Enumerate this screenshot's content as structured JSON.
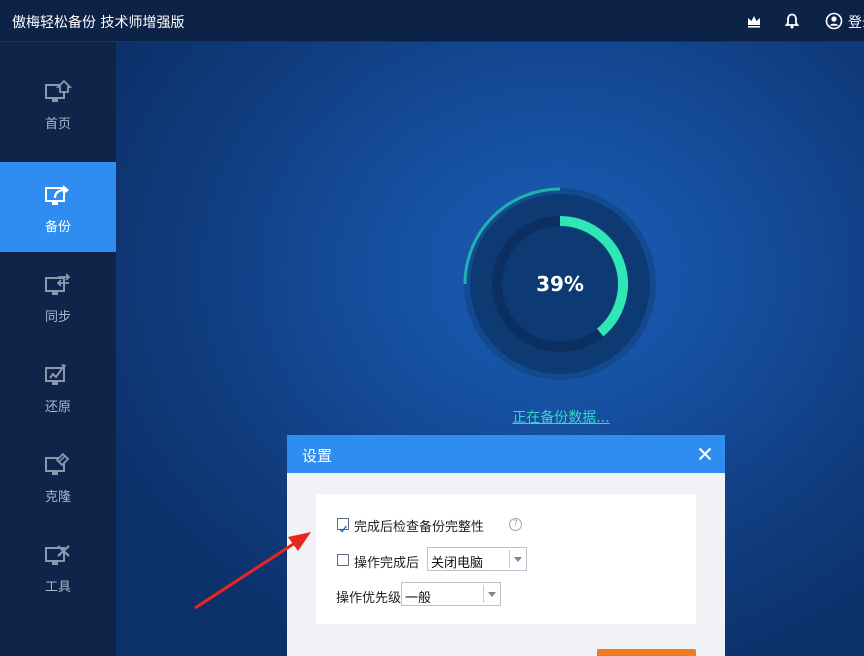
{
  "app": {
    "title": "傲梅轻松备份 技术师增强版",
    "login_label": "登录"
  },
  "titlebar_icons": [
    "crown-icon",
    "bell-icon",
    "user-icon"
  ],
  "sidebar": {
    "items": [
      {
        "label": "首页",
        "icon": "home-monitor-icon",
        "active": false
      },
      {
        "label": "备份",
        "icon": "backup-monitor-icon",
        "active": true
      },
      {
        "label": "同步",
        "icon": "sync-monitor-icon",
        "active": false
      },
      {
        "label": "还原",
        "icon": "restore-monitor-icon",
        "active": false
      },
      {
        "label": "克隆",
        "icon": "clone-monitor-icon",
        "active": false
      },
      {
        "label": "工具",
        "icon": "tools-monitor-icon",
        "active": false
      }
    ],
    "settings_icon": "gear-icon"
  },
  "progress": {
    "value": 0.39,
    "label": "39%",
    "status_text": "正在备份数据..."
  },
  "dialog": {
    "title": "设置",
    "options": {
      "verify_label": "完成后检查备份完整性",
      "verify_checked": true,
      "after_label": "操作完成后",
      "after_checked": false,
      "after_value": "关闭电脑",
      "priority_label": "操作优先级",
      "priority_value": "一般"
    }
  },
  "colors": {
    "accent": "#2f8df0",
    "progress": "#2ee6b6",
    "sidebar_bg": "#0f2448",
    "titlebar_bg": "#0c2347",
    "annotation_arrow": "#e8261f",
    "action_button": "#f07b1f"
  }
}
